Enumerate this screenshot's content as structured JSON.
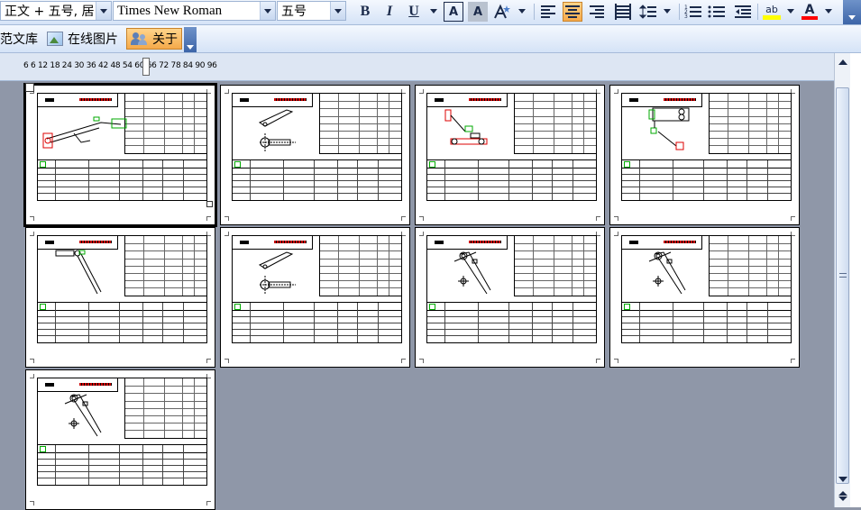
{
  "toolbar": {
    "style_value": "正文 + 五号, 居",
    "font_value": "Times New Roman",
    "size_value": "五号",
    "bold_label": "B",
    "italic_label": "I",
    "underline_label": "U",
    "char_border_label": "A",
    "char_shading_label": "A",
    "highlight_label": "ab",
    "font_color_label": "A"
  },
  "toolbar2": {
    "template_label": "范文库",
    "online_images_label": "在线图片",
    "about_label": "关于"
  },
  "ruler": {
    "numbers": "6   6  12 18 24 30  36 42 48  54 60 66 72 78 84 90 96"
  },
  "colors": {
    "highlight_yellow": "#ffff00",
    "font_red": "#ff0000",
    "active_orange": "#f5a94a"
  },
  "pages": [
    {
      "id": 1,
      "variant": "a"
    },
    {
      "id": 2,
      "variant": "b"
    },
    {
      "id": 3,
      "variant": "c"
    },
    {
      "id": 4,
      "variant": "d"
    },
    {
      "id": 5,
      "variant": "e"
    },
    {
      "id": 6,
      "variant": "b"
    },
    {
      "id": 7,
      "variant": "f"
    },
    {
      "id": 8,
      "variant": "f"
    },
    {
      "id": 9,
      "variant": "f"
    }
  ]
}
